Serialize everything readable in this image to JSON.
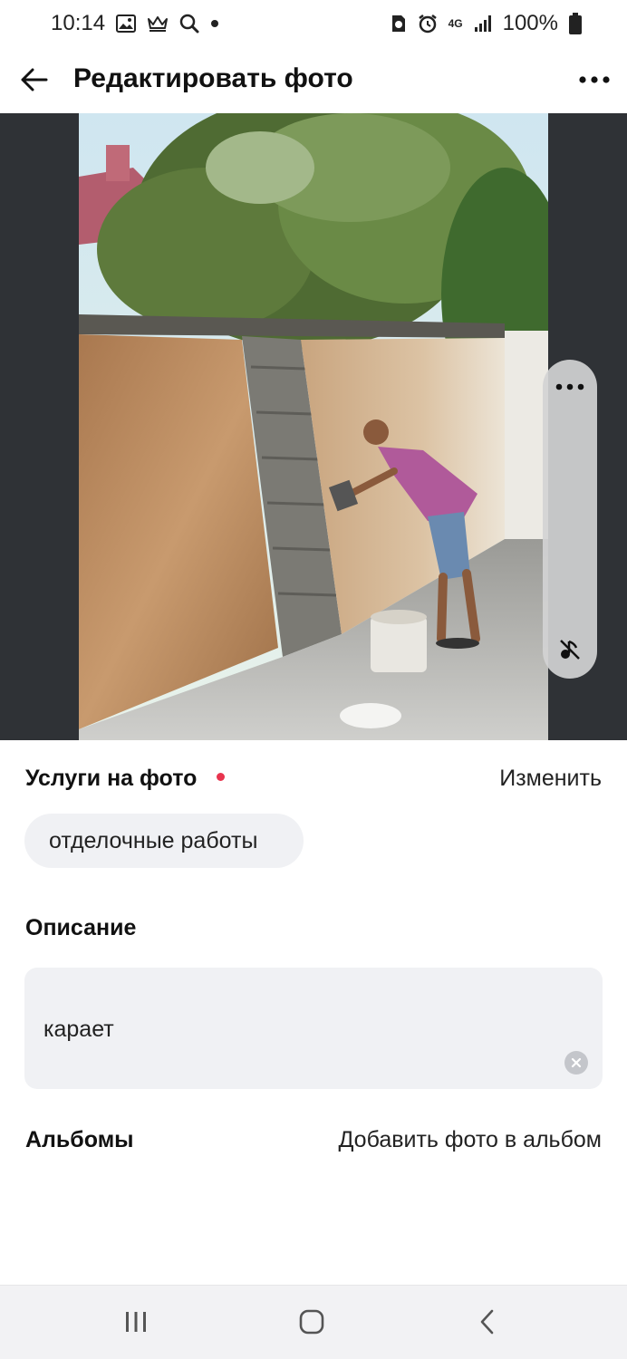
{
  "status_bar": {
    "time": "10:14",
    "network": "4G",
    "battery": "100%",
    "icons_left": [
      "image-icon",
      "crown-icon",
      "search-icon",
      "dot-icon"
    ],
    "icons_right": [
      "sim-icon",
      "alarm-icon",
      "network-icon",
      "signal-icon",
      "battery-icon"
    ]
  },
  "header": {
    "title": "Редактировать фото",
    "back_icon": "arrow-left-icon",
    "more_icon": "more-horizontal-icon"
  },
  "photo": {
    "description_icons": [
      "more-horizontal-icon",
      "mute-icon"
    ]
  },
  "services": {
    "title": "Услуги на фото",
    "change_label": "Изменить",
    "chips": [
      "отделочные работы"
    ],
    "required_color": "#e8344e"
  },
  "description": {
    "title": "Описание",
    "value": "карает"
  },
  "albums": {
    "title": "Альбомы",
    "add_label": "Добавить фото в альбом"
  },
  "nav": {
    "icons": [
      "recent-apps-icon",
      "home-icon",
      "back-icon"
    ]
  }
}
